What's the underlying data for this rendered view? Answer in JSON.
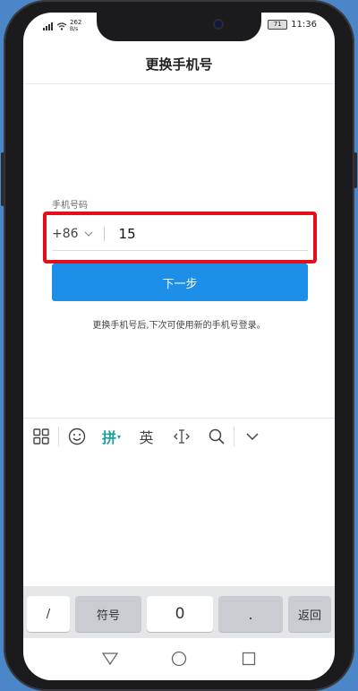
{
  "status_bar": {
    "net_speed": "262",
    "net_unit": "B/s",
    "battery": "71",
    "time": "11:36"
  },
  "page": {
    "title": "更换手机号"
  },
  "form": {
    "phone_label": "手机号码",
    "country_code": "+86",
    "phone_value": "15",
    "next_label": "下一步",
    "hint": "更换手机号后,下次可使用新的手机号登录。"
  },
  "ime_toolbar": {
    "items": [
      {
        "name": "grid-icon"
      },
      {
        "name": "emoji-icon"
      },
      {
        "label": "拼"
      },
      {
        "label": "英"
      },
      {
        "name": "cursor-icon"
      },
      {
        "name": "search-icon"
      },
      {
        "name": "collapse-keyboard-icon"
      }
    ]
  },
  "keyboard": {
    "slash": "/",
    "symbols": "符号",
    "zero": "0",
    "dot": ".",
    "back": "返回"
  },
  "colors": {
    "accent": "#1e8fe9",
    "highlight_box": "#e3101b",
    "ime_active": "#1a9fa0",
    "background": "#4a86c8"
  }
}
